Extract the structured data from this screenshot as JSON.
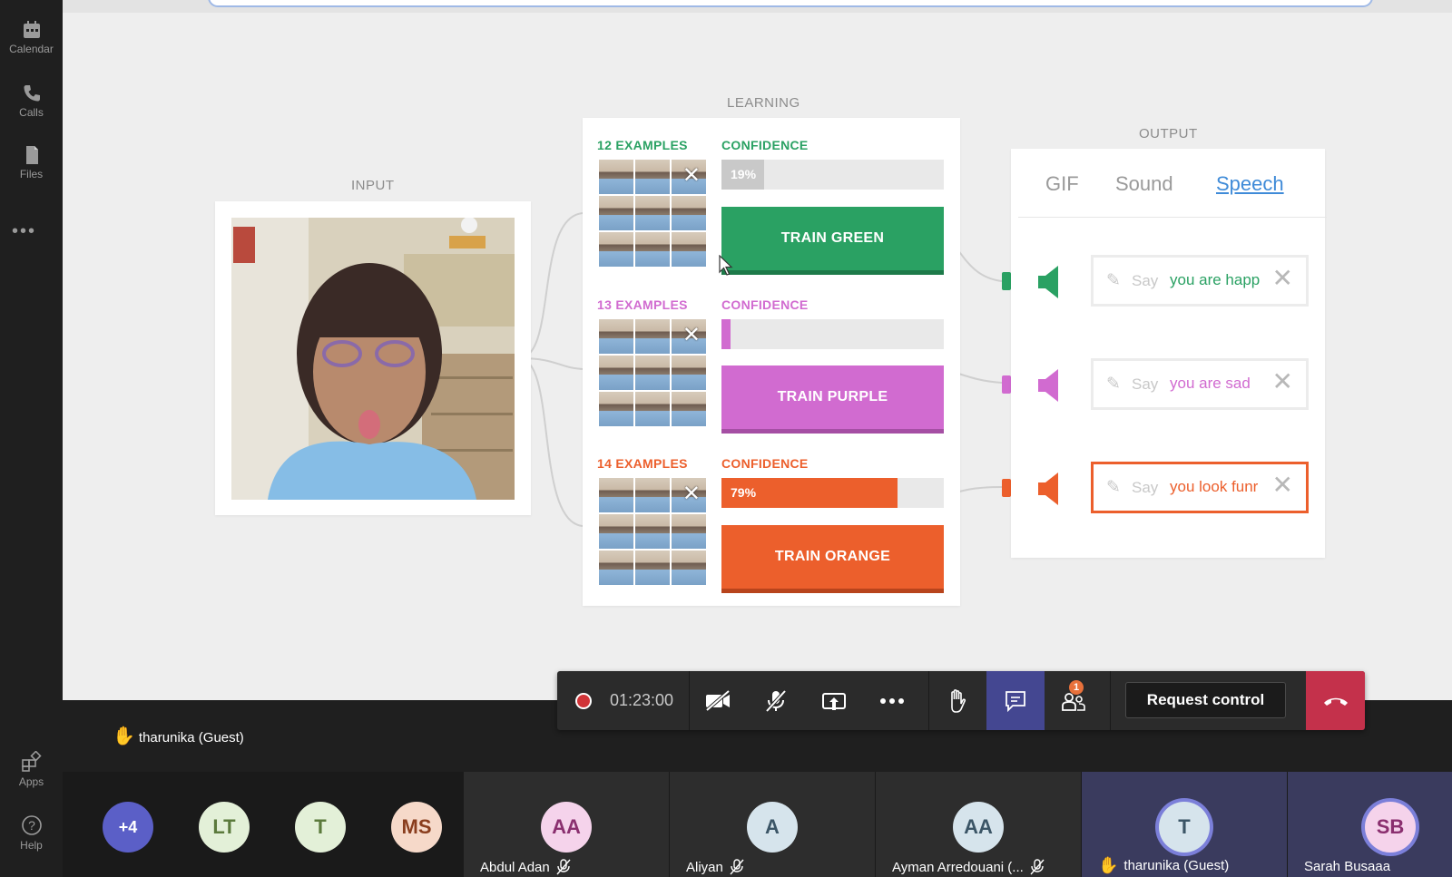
{
  "rail": {
    "items": [
      {
        "label": "Calendar",
        "icon": "calendar-icon"
      },
      {
        "label": "Calls",
        "icon": "phone-icon"
      },
      {
        "label": "Files",
        "icon": "file-icon"
      },
      {
        "label": "Apps",
        "icon": "apps-icon"
      },
      {
        "label": "Help",
        "icon": "help-icon"
      }
    ],
    "more": "•••"
  },
  "shared": {
    "input_title": "INPUT",
    "learning_title": "LEARNING",
    "output_title": "OUTPUT",
    "classes": [
      {
        "examples": "12 EXAMPLES",
        "confidence_label": "CONFIDENCE",
        "confidence_text": "19%",
        "confidence_value": 19,
        "train_label": "TRAIN GREEN",
        "color": "#2aa163"
      },
      {
        "examples": "13 EXAMPLES",
        "confidence_label": "CONFIDENCE",
        "confidence_text": "",
        "confidence_value": 0,
        "train_label": "TRAIN PURPLE",
        "color": "#d16bd0"
      },
      {
        "examples": "14 EXAMPLES",
        "confidence_label": "CONFIDENCE",
        "confidence_text": "79%",
        "confidence_value": 79,
        "train_label": "TRAIN ORANGE",
        "color": "#ec5f2c"
      }
    ],
    "output_tabs": [
      "GIF",
      "Sound",
      "Speech"
    ],
    "active_output_tab": "Speech",
    "say_placeholder": "Say",
    "speech_items": [
      {
        "text": "you are happ",
        "color": "#2aa163"
      },
      {
        "text": "you are sad",
        "color": "#d16bd0"
      },
      {
        "text": "you look funr",
        "color": "#ec5f2c"
      }
    ]
  },
  "toolbar": {
    "timer": "01:23:00",
    "request_control": "Request control",
    "apps_badge": "1"
  },
  "presenter": {
    "name": "tharunika (Guest)"
  },
  "participants": {
    "overflow": "+4",
    "mini": [
      {
        "initials": "LT",
        "bg": "#e3f0d8",
        "fg": "#5b7a3c"
      },
      {
        "initials": "T",
        "bg": "#e3f0d8",
        "fg": "#5b7a3c"
      },
      {
        "initials": "MS",
        "bg": "#f6d9c9",
        "fg": "#8a3e1e"
      }
    ],
    "tiles": [
      {
        "initials": "AA",
        "name": "Abdul Adan",
        "bg": "#f5d3eb",
        "fg": "#8a2f6f",
        "muted": true
      },
      {
        "initials": "A",
        "name": "Aliyan",
        "bg": "#d6e4ec",
        "fg": "#3b5566",
        "muted": true
      },
      {
        "initials": "AA",
        "name": "Ayman Arredouani (...",
        "bg": "#d6e4ec",
        "fg": "#3b5566",
        "muted": true
      },
      {
        "initials": "T",
        "name": "tharunika (Guest)",
        "bg": "#d6e4ec",
        "fg": "#3b5566",
        "muted": false
      },
      {
        "initials": "SB",
        "name": "Sarah Busaaa",
        "bg": "#f5d3eb",
        "fg": "#8a2f6f",
        "muted": false
      }
    ]
  }
}
